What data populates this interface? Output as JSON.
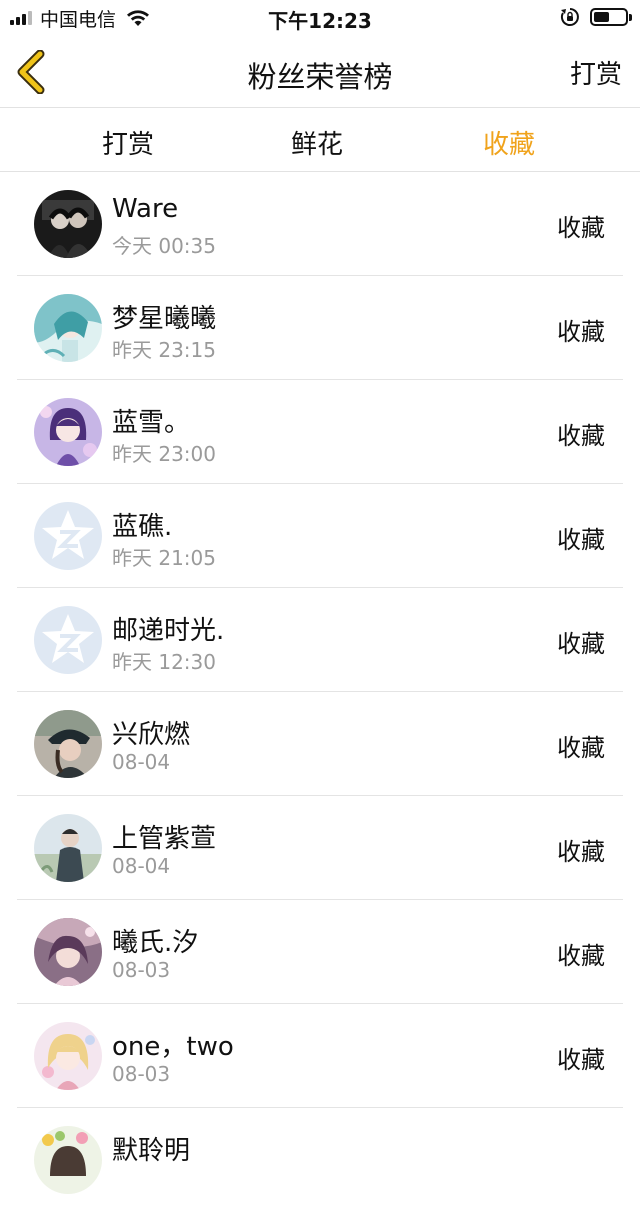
{
  "status_bar": {
    "carrier": "中国电信",
    "time": "下午12:23",
    "signal_bars": 4,
    "signal_active": 3,
    "battery_level": 0.5
  },
  "nav": {
    "title": "粉丝荣誉榜",
    "right_action": "打赏",
    "back_icon": "chevron-left-icon",
    "back_color": "#f0c419"
  },
  "tabs": {
    "items": [
      "打赏",
      "鲜花",
      "收藏"
    ],
    "active_index": 2,
    "active_color": "#f0a31c"
  },
  "list": [
    {
      "name": "Ware",
      "time": "今天 00:35",
      "action": "收藏",
      "avatar": "dark-photo"
    },
    {
      "name": "梦星曦曦",
      "time": "昨天 23:15",
      "action": "收藏",
      "avatar": "teal-anime"
    },
    {
      "name": "蓝雪。",
      "time": "昨天 23:00",
      "action": "收藏",
      "avatar": "purple-anime"
    },
    {
      "name": "蓝礁.",
      "time": "昨天 21:05",
      "action": "收藏",
      "avatar": "default-qzone"
    },
    {
      "name": "邮递时光.",
      "time": "昨天 12:30",
      "action": "收藏",
      "avatar": "default-qzone"
    },
    {
      "name": "兴欣燃",
      "time": "08-04",
      "action": "收藏",
      "avatar": "cap-photo"
    },
    {
      "name": "上管紫萱",
      "time": "08-04",
      "action": "收藏",
      "avatar": "outdoor-photo"
    },
    {
      "name": "曦氏.汐",
      "time": "08-03",
      "action": "收藏",
      "avatar": "pink-anime"
    },
    {
      "name": "one，two",
      "time": "08-03",
      "action": "收藏",
      "avatar": "blonde-anime"
    },
    {
      "name": "默聆明",
      "time": "",
      "action": "",
      "avatar": "flower-anime"
    }
  ]
}
